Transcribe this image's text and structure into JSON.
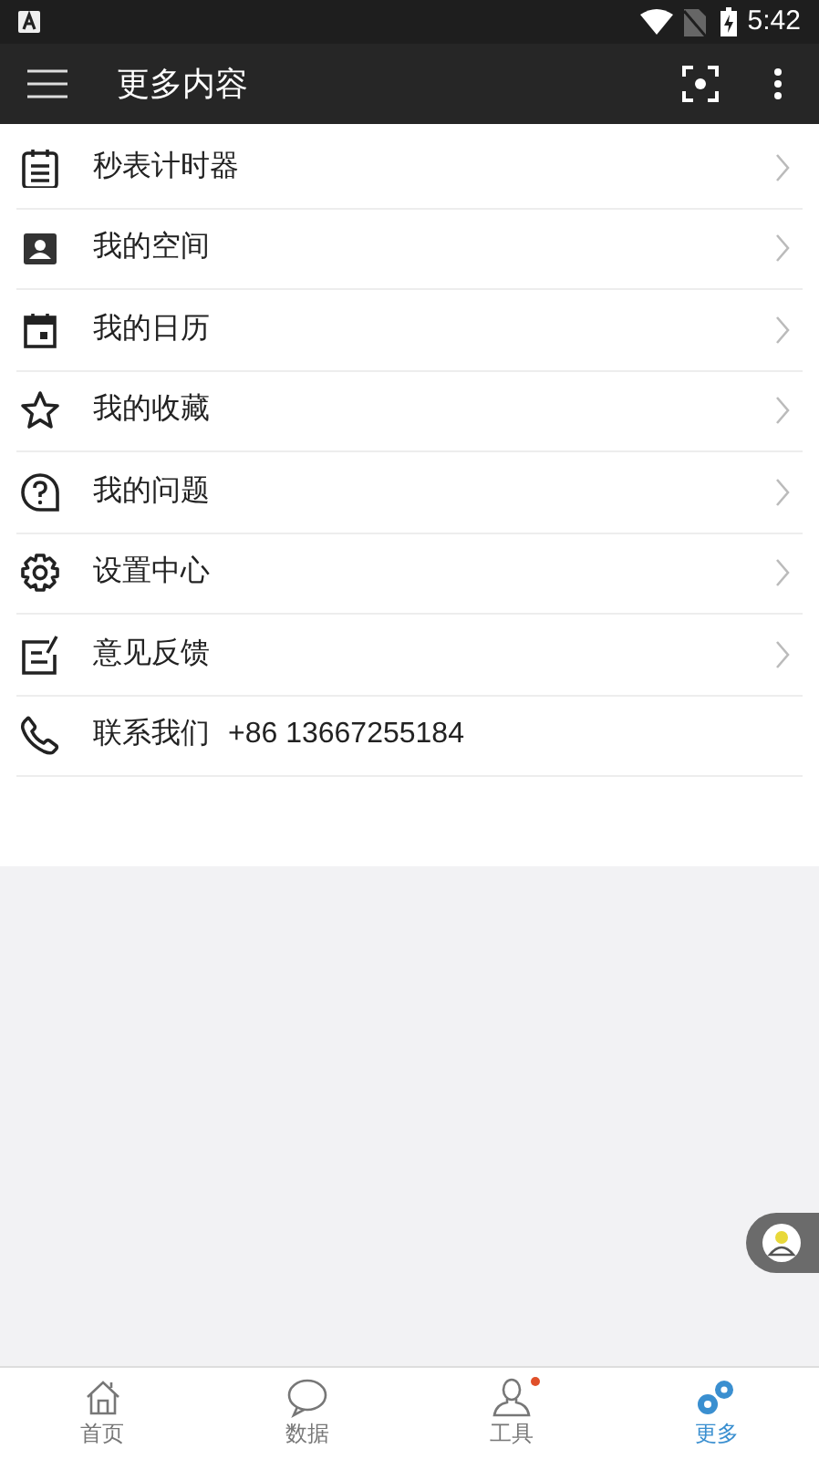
{
  "status_bar": {
    "time": "5:42"
  },
  "toolbar": {
    "title": "更多内容"
  },
  "menu": [
    {
      "kind": "link",
      "label": "秒表计时器"
    },
    {
      "kind": "link",
      "label": "我的空间"
    },
    {
      "kind": "link",
      "label": "我的日历"
    },
    {
      "kind": "link",
      "label": "我的收藏"
    },
    {
      "kind": "link",
      "label": "我的问题"
    },
    {
      "kind": "link",
      "label": "设置中心"
    },
    {
      "kind": "link",
      "label": "意见反馈"
    },
    {
      "kind": "contact",
      "label": "联系我们",
      "phone": "+86 13667255184"
    }
  ],
  "bottom_nav": [
    {
      "label": "首页",
      "selected": false,
      "badge": false
    },
    {
      "label": "数据",
      "selected": false,
      "badge": false
    },
    {
      "label": "工具",
      "selected": false,
      "badge": true
    },
    {
      "label": "更多",
      "selected": true,
      "badge": false
    }
  ]
}
